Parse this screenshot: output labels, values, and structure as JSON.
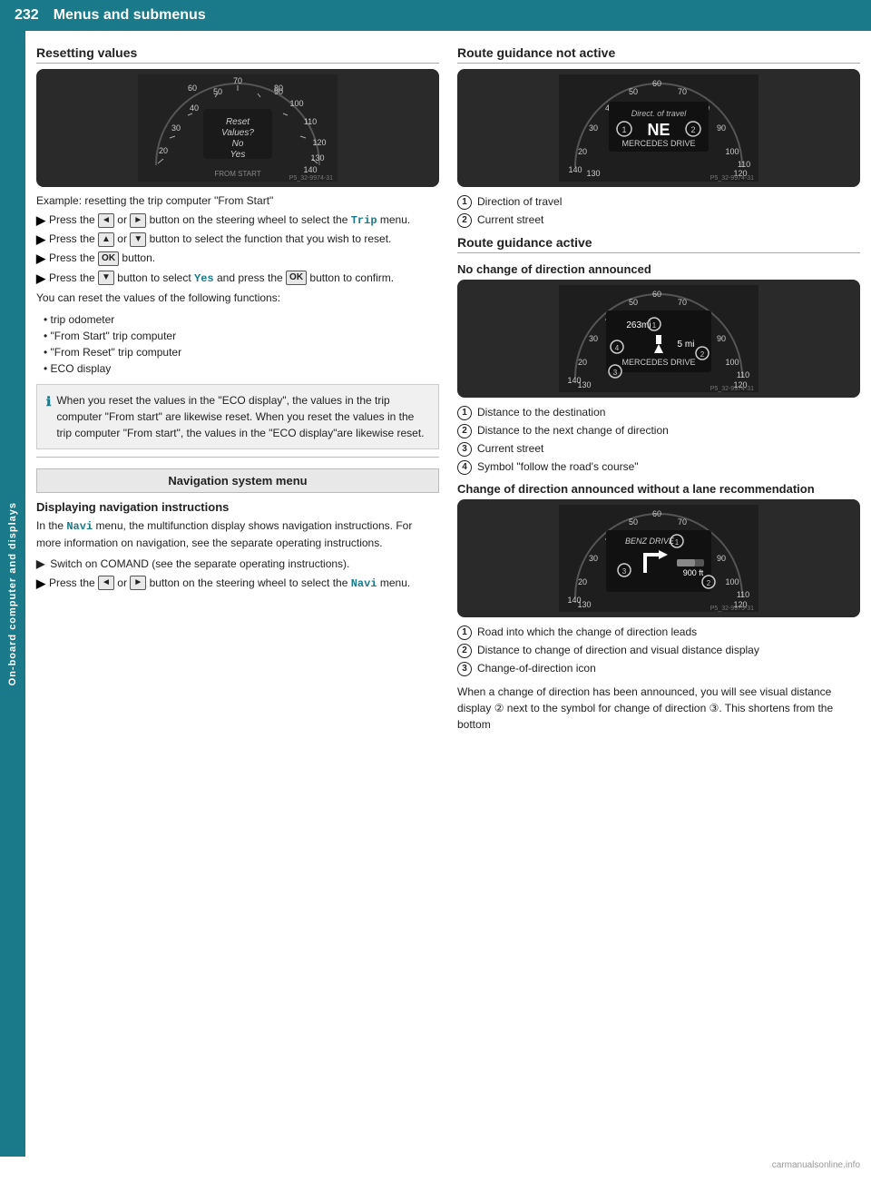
{
  "header": {
    "page_number": "232",
    "title": "Menus and submenus"
  },
  "sidebar": {
    "label": "On-board computer and displays"
  },
  "left_column": {
    "section_title": "Resetting values",
    "example_text": "Example: resetting the trip computer \"From Start\"",
    "instructions": [
      {
        "id": 1,
        "text_before": "Press the",
        "btn1": "◄",
        "text_mid": "or",
        "btn2": "►",
        "text_after": "button on the steering wheel to select the",
        "mono": "Trip",
        "text_end": "menu."
      },
      {
        "id": 2,
        "text_before": "Press the",
        "btn1": "▲",
        "text_mid": "or",
        "btn2": "▼",
        "text_after": "button to select the function that you wish to reset."
      },
      {
        "id": 3,
        "text_before": "Press the",
        "btn1": "OK",
        "text_after": "button."
      },
      {
        "id": 4,
        "text_before": "Press the",
        "btn1": "▼",
        "text_after": "button to select",
        "mono": "Yes",
        "text_end": "and press the",
        "btn2": "OK",
        "text_end2": "button to confirm."
      }
    ],
    "can_reset_text": "You can reset the values of the following functions:",
    "bullet_items": [
      "trip odometer",
      "\"From Start\" trip computer",
      "\"From Reset\" trip computer",
      "ECO display"
    ],
    "info_box_text": "When you reset the values in the \"ECO display\", the values in the trip computer \"From start\" are likewise reset. When you reset the values in the trip computer \"From start\", the values in the \"ECO display\"are likewise reset.",
    "nav_sys_menu_label": "Navigation system menu",
    "displaying_nav_title": "Displaying navigation instructions",
    "displaying_nav_para": "In the Navi menu, the multifunction display shows navigation instructions. For more information on navigation, see the separate operating instructions.",
    "switch_on_text": "Switch on COMAND (see the separate operating instructions).",
    "press_instruction_navi": {
      "text_before": "Press the",
      "btn1": "◄",
      "text_mid": "or",
      "btn2": "►",
      "text_after": "button on the steering wheel to select the",
      "mono": "Navi",
      "text_end": "menu."
    }
  },
  "right_column": {
    "route_guidance_not_active": {
      "title": "Route guidance not active",
      "numbered_items": [
        "Direction of travel",
        "Current street"
      ]
    },
    "route_guidance_active": {
      "title": "Route guidance active"
    },
    "no_change_direction": {
      "title": "No change of direction announced",
      "numbered_items": [
        "Distance to the destination",
        "Distance to the next change of direction",
        "Current street",
        "Symbol \"follow the road's course\""
      ]
    },
    "change_direction_title": "Change of direction announced without a lane recommendation",
    "change_direction_numbered": [
      "Road into which the change of direction leads",
      "Distance to change of direction and visual distance display",
      "Change-of-direction icon"
    ],
    "change_direction_para": "When a change of direction has been announced, you will see visual distance display ② next to the symbol for change of direction ③. This shortens from the bottom"
  },
  "speedometer_1": {
    "label": "Reset Values? No Yes",
    "from_start": "FROM START",
    "photo_ref": "P5_32-9974-31"
  },
  "speedometer_2": {
    "label": "Direct. of travel",
    "ne_text": "NE",
    "street": "MERCEDES DRIVE",
    "photo_ref": "P5_32-9974-31"
  },
  "speedometer_3": {
    "dist1": "263mi",
    "dist2": "5 mi",
    "street": "MERCEDES DRIVE",
    "photo_ref": "P5_32-9974-31"
  },
  "speedometer_4": {
    "street": "BENZ DRIVE",
    "dist": "900 ft",
    "photo_ref": "P5_32-9975-31"
  },
  "watermark": "carmanualsonline.info"
}
